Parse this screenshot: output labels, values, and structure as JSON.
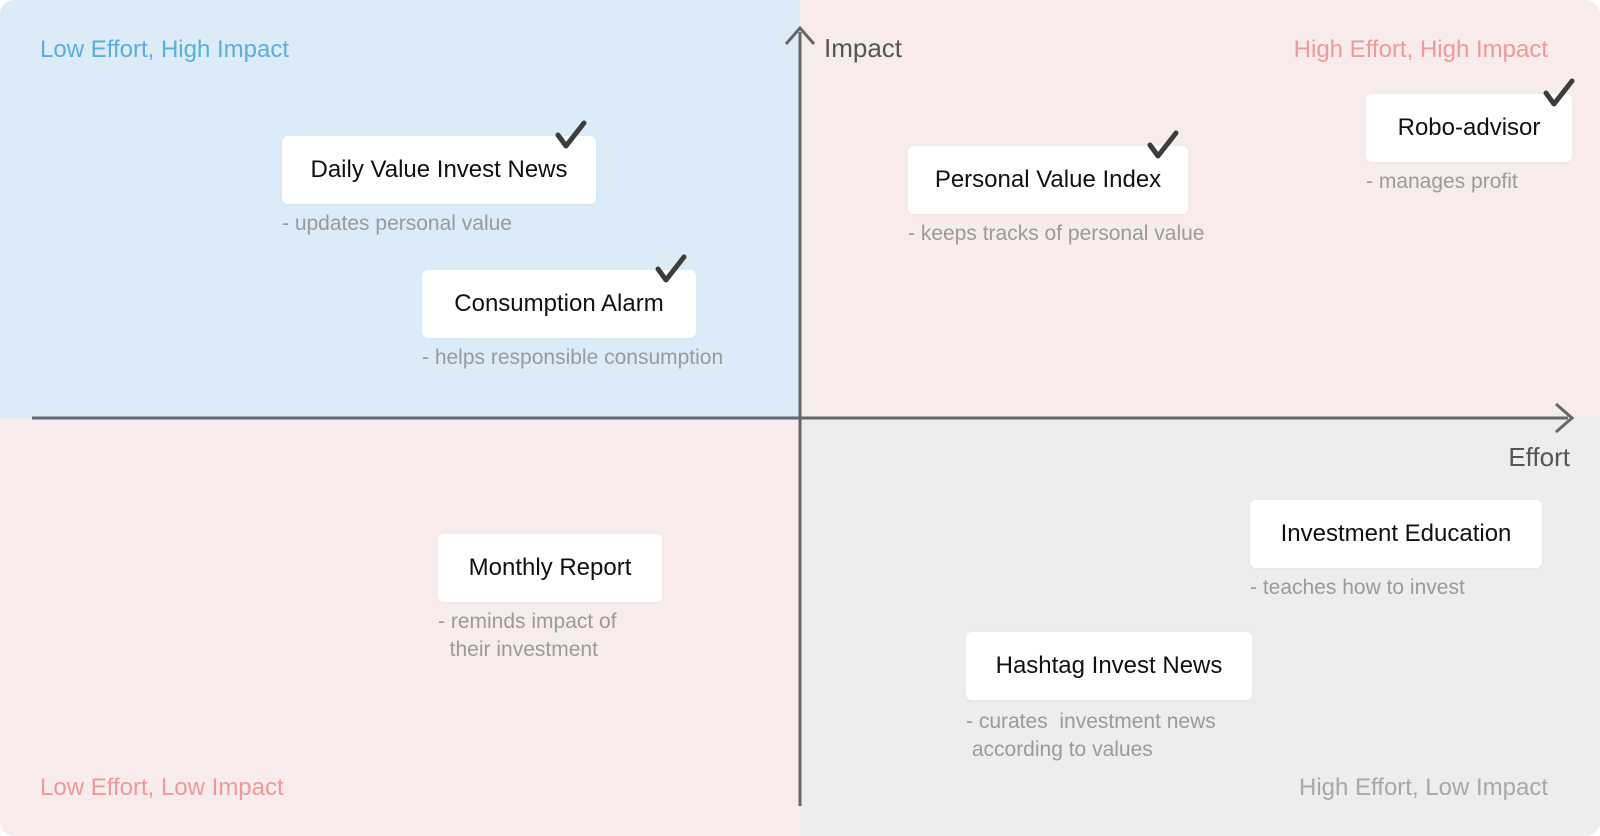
{
  "quadrants": {
    "top_left": "Low Effort, High Impact",
    "top_right": "High Effort, High Impact",
    "bottom_left": "Low Effort, Low Impact",
    "bottom_right": "High Effort, Low Impact"
  },
  "colors": {
    "top_left_bg": "#dbebf7",
    "top_right_bg": "#f7eceb",
    "bottom_left_bg": "#f7eceb",
    "bottom_right_bg": "#ededed",
    "axis": "#666666",
    "checkmark": "#3d3d3d"
  },
  "axes": {
    "y_label": "Impact",
    "x_label": "Effort"
  },
  "items": [
    {
      "title": "Daily Value Invest News",
      "description": "- updates personal value",
      "checked": true
    },
    {
      "title": "Consumption Alarm",
      "description": "- helps responsible consumption",
      "checked": true
    },
    {
      "title": "Personal Value Index",
      "description": "- keeps tracks of personal value",
      "checked": true
    },
    {
      "title": "Robo-advisor",
      "description": "- manages profit",
      "checked": true
    },
    {
      "title": "Monthly Report",
      "description": "- reminds impact of\n  their investment",
      "checked": false
    },
    {
      "title": "Investment Education",
      "description": "- teaches how to invest",
      "checked": false
    },
    {
      "title": "Hashtag Invest News",
      "description": "- curates  investment news\n according to values",
      "checked": false
    }
  ]
}
